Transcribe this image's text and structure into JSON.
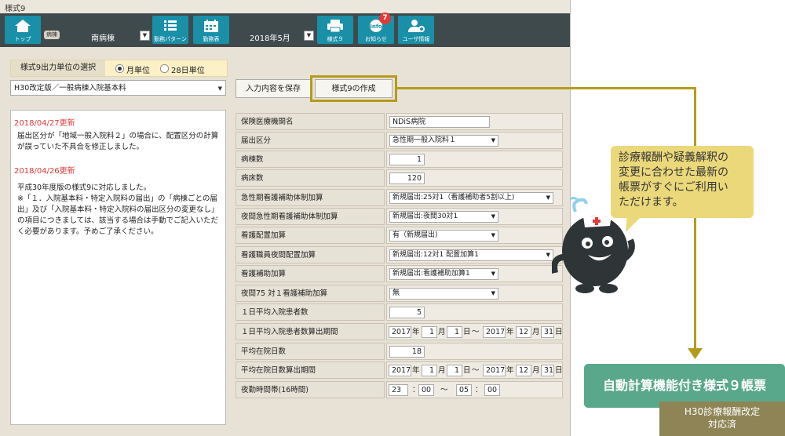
{
  "window": {
    "title": "様式9"
  },
  "toolbar": {
    "top_label": "トップ",
    "ward_pill": "病棟",
    "ward_value": "南病棟",
    "pattern_label": "勤務パターン",
    "roster_label": "勤務表",
    "month_value": "2018年5月",
    "form9_label": "様式９",
    "news_label": "お知らせ",
    "news_icon_text": "Info",
    "news_badge": "7",
    "user_label": "ユーザ情報"
  },
  "unit_select": {
    "label": "様式9出力単位の選択",
    "options": [
      {
        "label": "月単位",
        "selected": true
      },
      {
        "label": "28日単位",
        "selected": false
      }
    ]
  },
  "version_select": "H30改定版／一般病棟入院基本料",
  "buttons": {
    "save": "入力内容を保存",
    "create": "様式9の作成"
  },
  "notes": [
    {
      "date": "2018/04/27更新",
      "text": "届出区分が「地域一般入院料２」の場合に、配置区分の計算が誤っていた不具合を修正しました。"
    },
    {
      "date": "2018/04/26更新",
      "text": "平成30年度版の様式9に対応しました。\n※「１．入院基本料・特定入院料の届出」の「病棟ごとの届出」及び「入院基本料・特定入院料の届出区分の変更なし」の項目につきましては、該当する場合は手動でご記入いただく必要があります。予めご了承ください。"
    }
  ],
  "form": {
    "institution": {
      "label": "保険医療機関名",
      "value": "NDiS病院"
    },
    "category": {
      "label": "届出区分",
      "value": "急性期一般入院料１"
    },
    "wards": {
      "label": "病棟数",
      "value": "1"
    },
    "beds": {
      "label": "病床数",
      "value": "120"
    },
    "acute_assist": {
      "label": "急性期看護補助体制加算",
      "value": "新規届出:25対1（看護補助者5割以上)"
    },
    "night_acute_assist": {
      "label": "夜間急性期看護補助体制加算",
      "value": "新規届出:夜間30対1"
    },
    "nurse_placement": {
      "label": "看護配置加算",
      "value": "有（新規届出)"
    },
    "night_staff": {
      "label": "看護職員夜間配置加算",
      "value": "新規届出:12対1 配置加算1"
    },
    "nurse_assist": {
      "label": "看護補助加算",
      "value": "新規届出:看護補助加算1"
    },
    "night75": {
      "label": "夜間75 対１看護補助加算",
      "value": "無"
    },
    "daily_patients": {
      "label": "１日平均入院患者数",
      "value": "5"
    },
    "patients_period": {
      "label": "１日平均入院患者数算出期間",
      "from_year": "2017",
      "from_month": "1",
      "from_day": "1",
      "to_year": "2017",
      "to_month": "12",
      "to_day": "31"
    },
    "avg_stay": {
      "label": "平均在院日数",
      "value": "18"
    },
    "stay_period": {
      "label": "平均在院日数算出期間",
      "from_year": "2017",
      "from_month": "1",
      "from_day": "1",
      "to_year": "2017",
      "to_month": "12",
      "to_day": "31"
    },
    "night_hours": {
      "label": "夜勤時間帯(16時間)",
      "from_h": "23",
      "from_m": "00",
      "to_h": "05",
      "to_m": "00"
    }
  },
  "units": {
    "year": "年",
    "month": "月",
    "day": "日",
    "tilde": "～",
    "colon": "：",
    "tilde2": "〜"
  },
  "callout": {
    "bubble": [
      "診療報酬や疑義解釈の",
      "変更に合わせた最新の",
      "帳票がすぐにご利用い",
      "ただけます。"
    ],
    "feature": "自動計算機能付き様式９帳票",
    "badge": [
      "H30診療報酬改定",
      "対応済"
    ]
  },
  "colors": {
    "toolbar": "#3f4a4c",
    "button": "#1a8fa8",
    "highlight": "#b59b1c",
    "date": "#e53935",
    "feature": "#5aa88c",
    "badge": "#8e8455"
  }
}
